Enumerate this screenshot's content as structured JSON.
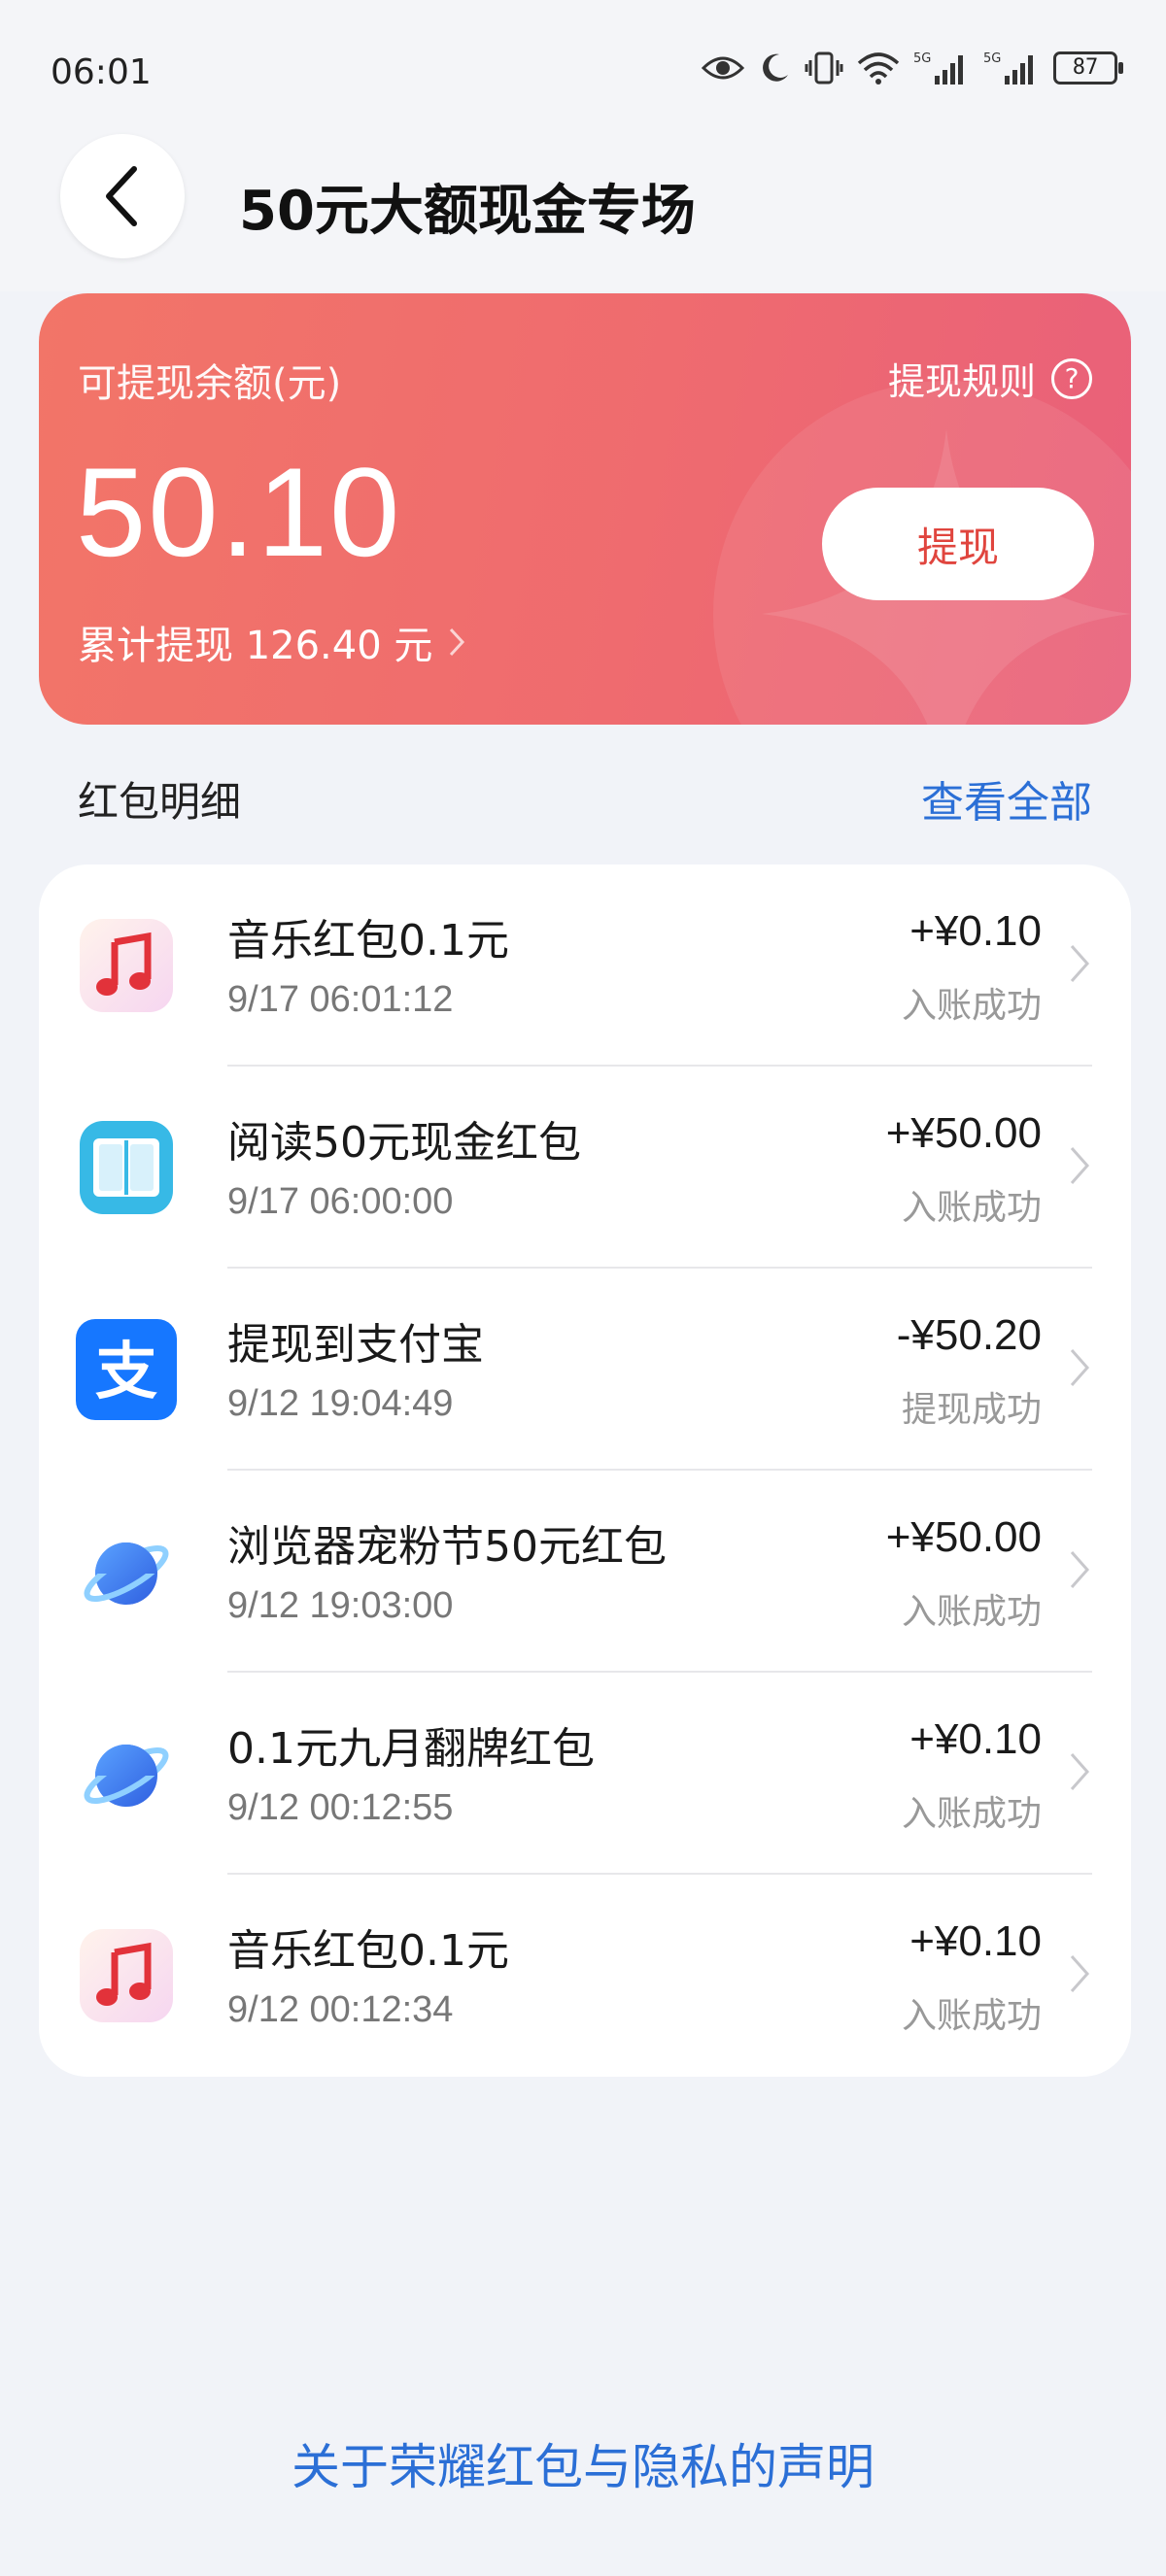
{
  "status_bar": {
    "time": "06:01",
    "battery": "87",
    "signal_label_1": "5G",
    "signal_label_2": "5G"
  },
  "header": {
    "title": "50元大额现金专场"
  },
  "balance_card": {
    "label": "可提现余额(元)",
    "amount": "50.10",
    "rules_label": "提现规则",
    "rules_icon": "?",
    "cumulative_text": "累计提现 126.40 元",
    "withdraw_label": "提现",
    "colors": {
      "start": "#f27568",
      "end": "#e9607a",
      "button_text": "#e0453e"
    }
  },
  "section": {
    "title": "红包明细",
    "view_all": "查看全部"
  },
  "records": [
    {
      "icon": "music-icon",
      "name": "音乐红包0.1元",
      "time": "9/17 06:01:12",
      "amount": "+¥0.10",
      "status": "入账成功"
    },
    {
      "icon": "reading-icon",
      "name": "阅读50元现金红包",
      "time": "9/17 06:00:00",
      "amount": "+¥50.00",
      "status": "入账成功"
    },
    {
      "icon": "alipay-icon",
      "name": "提现到支付宝",
      "time": "9/12 19:04:49",
      "amount": "-¥50.20",
      "status": "提现成功"
    },
    {
      "icon": "browser-icon",
      "name": "浏览器宠粉节50元红包",
      "time": "9/12 19:03:00",
      "amount": "+¥50.00",
      "status": "入账成功"
    },
    {
      "icon": "browser-icon",
      "name": "0.1元九月翻牌红包",
      "time": "9/12 00:12:55",
      "amount": "+¥0.10",
      "status": "入账成功"
    },
    {
      "icon": "music-icon",
      "name": "音乐红包0.1元",
      "time": "9/12 00:12:34",
      "amount": "+¥0.10",
      "status": "入账成功"
    }
  ],
  "alipay_glyph": "支",
  "footer": {
    "privacy_link": "关于荣耀红包与隐私的声明"
  },
  "colors": {
    "link_blue": "#2b6fd6",
    "background": "#f1f3f8"
  }
}
